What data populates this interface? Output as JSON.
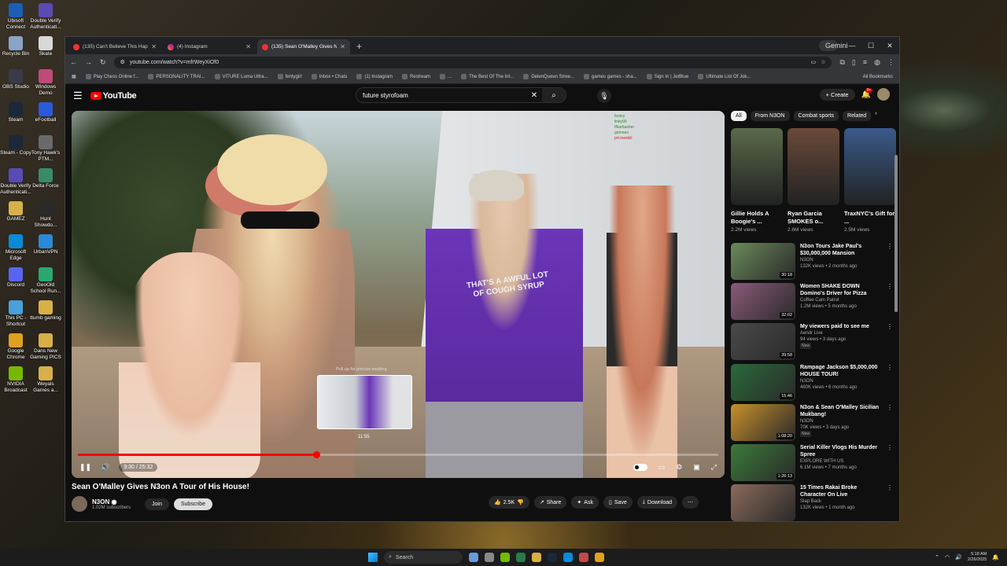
{
  "desktop": {
    "icons": [
      {
        "label": "Ubisoft Connect",
        "color": "#1a5fb4"
      },
      {
        "label": "Double Verify Authenticati...",
        "color": "#5a4ab4"
      },
      {
        "label": "Recycle Bin",
        "color": "#8aa4c8"
      },
      {
        "label": "Skate",
        "color": "#d8d8d8"
      },
      {
        "label": "OBS Studio",
        "color": "#3a3a4a"
      },
      {
        "label": "Windows Demo",
        "color": "#c04a7a"
      },
      {
        "label": "Steam",
        "color": "#1b2838"
      },
      {
        "label": "eFootball",
        "color": "#2a5ad8"
      },
      {
        "label": "Steam - Copy",
        "color": "#1b2838"
      },
      {
        "label": "Tony Hawk's PTM...",
        "color": "#6a6a6a"
      },
      {
        "label": "Double Verify Authenticati...",
        "color": "#5a4ab4"
      },
      {
        "label": "Delta Force",
        "color": "#3a8a6a"
      },
      {
        "label": "GAMEZ",
        "color": "#d8b04a"
      },
      {
        "label": "Hunt Showdo...",
        "color": "#2a2a2a"
      },
      {
        "label": "Microsoft Edge",
        "color": "#0a8ad8"
      },
      {
        "label": "UrbanVPN",
        "color": "#2a8ad8"
      },
      {
        "label": "Discord",
        "color": "#5865f2"
      },
      {
        "label": "GeoOld School Run...",
        "color": "#2aa870"
      },
      {
        "label": "This PC - Shortcut",
        "color": "#4aa0d8"
      },
      {
        "label": "ttumb gaming",
        "color": "#d8b04a"
      },
      {
        "label": "Google Chrome",
        "color": "#e0a020"
      },
      {
        "label": "Dans New Gaming PICS",
        "color": "#d8b04a"
      },
      {
        "label": "NVIDIA Broadcast",
        "color": "#76b900"
      },
      {
        "label": "Weyals Games a...",
        "color": "#d8b04a"
      }
    ]
  },
  "browser": {
    "tabs": [
      {
        "title": "(135) Can't Believe This Happen",
        "icon": "youtube-icon",
        "active": false
      },
      {
        "title": "(4) Instagram",
        "icon": "instagram-icon",
        "active": false
      },
      {
        "title": "(135) Sean O'Malley Gives N",
        "icon": "youtube-icon",
        "active": true
      }
    ],
    "gemini_label": "Gemini",
    "url": "youtube.com/watch?v=mfrWeyXiOf0",
    "bookmarks": [
      "Play Chess Online f...",
      "PERSONALITY TRAI...",
      "VITURE Luma Ultra...",
      "fentygirl",
      "Inbox • Chats",
      "(1) Instagram",
      "Restream",
      "...",
      "The Best Of The Int...",
      "DelenQueen Stree...",
      "games games - sha...",
      "Sign In | JetBlue",
      "Ultimate List Of Jok..."
    ],
    "all_bookmarks": "All Bookmarks"
  },
  "youtube": {
    "logo": "YouTube",
    "search_value": "future styrofoam",
    "create_label": "Create",
    "notif_count": "9+",
    "video": {
      "overlay_text": "THAT'S A AWFUL LOT OF COUGH SYRUP",
      "pull_hint": "Pull up for precise seeking",
      "preview_time": "11:55",
      "time": "9:30 / 25:32",
      "progress": 0.372,
      "chat_lines": [
        "fooley",
        "linky99",
        "tfkarbasher",
        "gomeeo",
        "prt.meskiii"
      ]
    },
    "title": "Sean O'Malley Gives N3on A Tour of His House!",
    "channel": {
      "name": "N3ON",
      "subscribers": "1.02M subscribers"
    },
    "join_label": "Join",
    "subscribe_label": "Subscribe",
    "actions": {
      "like_count": "2.5K",
      "share": "Share",
      "ask": "Ask",
      "save": "Save",
      "download": "Download"
    },
    "chips": [
      "All",
      "From N3ON",
      "Combat sports",
      "Related"
    ],
    "shorts": [
      {
        "title": "Gillie Holds A Boogie's ...",
        "views": "2.2M views",
        "color": "#5a6a4a"
      },
      {
        "title": "Ryan Garcia SMOKES o...",
        "views": "2.6M views",
        "color": "#6a4a3a"
      },
      {
        "title": "TraxNYC's Gift for ...",
        "views": "2.5M views",
        "color": "#3a5a8a"
      }
    ],
    "recommendations": [
      {
        "title": "N3on Tours Jake Paul's $30,000,000 Mansion",
        "channel": "N3ON",
        "meta": "132K views • 2 months ago",
        "duration": "30:18",
        "new": false,
        "color": "#6a8a5a"
      },
      {
        "title": "Women SHAKE DOWN Domino's Driver for Pizza",
        "channel": "Coffee Cam Patrol",
        "meta": "1.2M views • 5 months ago",
        "duration": "32:02",
        "new": false,
        "color": "#8a5a7a"
      },
      {
        "title": "My viewers paid to see me",
        "channel": "Aendr Live",
        "meta": "94 views • 3 days ago",
        "duration": "39:58",
        "new": true,
        "color": "#4a4a4a"
      },
      {
        "title": "Rampage Jackson $5,000,000 HOUSE TOUR!",
        "channel": "N3ON",
        "meta": "460K views • 6 months ago",
        "duration": "15:46",
        "new": false,
        "color": "#2a6a3a"
      },
      {
        "title": "N3on & Sean O'Malley Sicilian Mukbang!",
        "channel": "N3ON",
        "meta": "70K views • 3 days ago",
        "duration": "1:08:20",
        "new": true,
        "color": "#c8902a"
      },
      {
        "title": "Serial Killer Vlogs His Murder Spree",
        "channel": "EXPLORE WITH US",
        "meta": "6.1M views • 7 months ago",
        "duration": "1:26:13",
        "new": false,
        "color": "#3a7a3a"
      },
      {
        "title": "15 Times Rakai Broke Character On Live",
        "channel": "Slap Back",
        "meta": "132K views • 1 month ago",
        "duration": "",
        "new": false,
        "color": "#8a6a5a"
      }
    ]
  },
  "taskbar": {
    "search_placeholder": "Search",
    "time": "5:18 AM",
    "date": "2/26/2025"
  }
}
